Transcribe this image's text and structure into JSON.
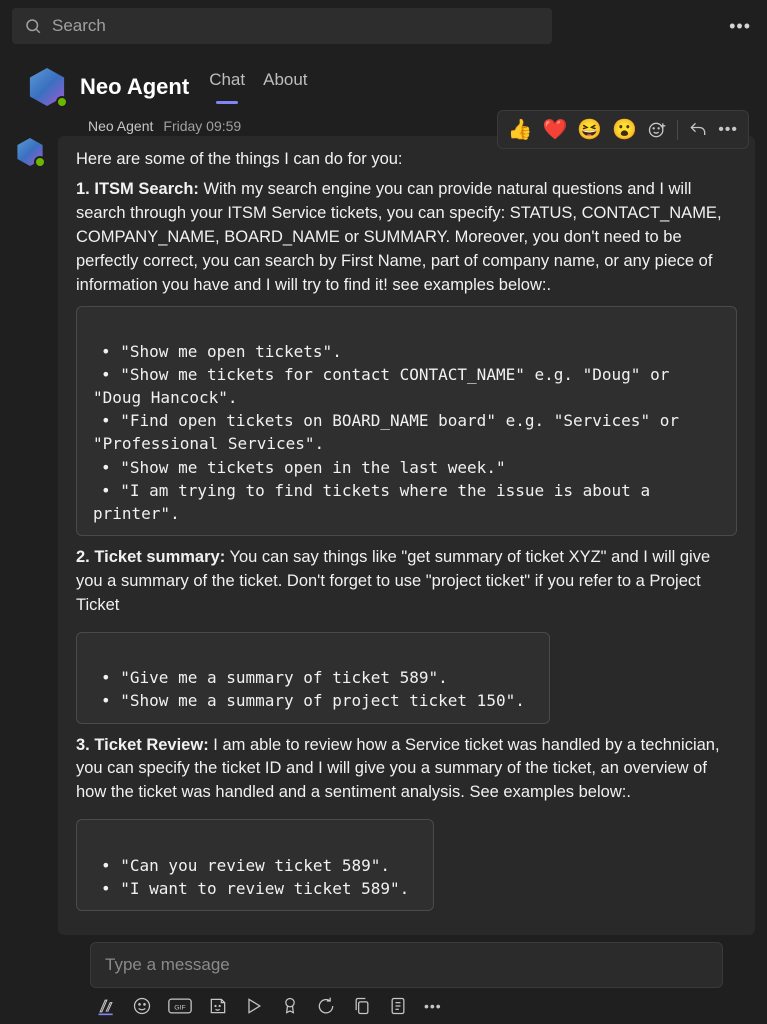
{
  "search": {
    "placeholder": "Search"
  },
  "header": {
    "bot_name": "Neo Agent",
    "tabs": {
      "chat": "Chat",
      "about": "About"
    }
  },
  "message": {
    "sender": "Neo Agent",
    "time": "Friday 09:59",
    "intro": "Here are some of the things I can do for you:",
    "section1": {
      "num": "1.",
      "title": "ITSM Search:",
      "body": "With my search engine you can provide natural questions and I will search through your ITSM Service tickets, you can specify: STATUS, CONTACT_NAME, COMPANY_NAME, BOARD_NAME or SUMMARY. Moreover, you don't need to be perfectly correct, you can search by First Name, part of company name, or any piece of information you have and I will try to find it! see examples below:.",
      "examples": [
        "\"Show me open tickets\".",
        "\"Show me tickets for contact CONTACT_NAME\" e.g. \"Doug\" or \"Doug Hancock\".",
        "\"Find open tickets on BOARD_NAME board\" e.g. \"Services\" or \"Professional Services\".",
        "\"Show me tickets open in the last week.\"",
        "\"I am trying to find tickets where the issue is about a printer\"."
      ]
    },
    "section2": {
      "num": "2.",
      "title": "Ticket summary:",
      "body": "You can say things like \"get summary of ticket XYZ\" and I will give you a summary of the ticket. Don't forget to use \"project ticket\" if you refer to a Project Ticket",
      "examples": [
        "\"Give me a summary of ticket 589\".",
        "\"Show me a summary of project ticket 150\"."
      ]
    },
    "section3": {
      "num": "3.",
      "title": "Ticket Review:",
      "body": "I am able to review how a Service ticket was handled by a technician, you can specify the ticket ID and I will give you a summary of the ticket, an overview of how the ticket was handled and a sentiment analysis. See examples below:.",
      "examples": [
        "\"Can you review ticket 589\".",
        "\"I want to review ticket 589\"."
      ]
    }
  },
  "reactions": {
    "like": "👍",
    "heart": "❤️",
    "laugh": "😆",
    "surprised": "😮"
  },
  "compose": {
    "placeholder": "Type a message"
  }
}
